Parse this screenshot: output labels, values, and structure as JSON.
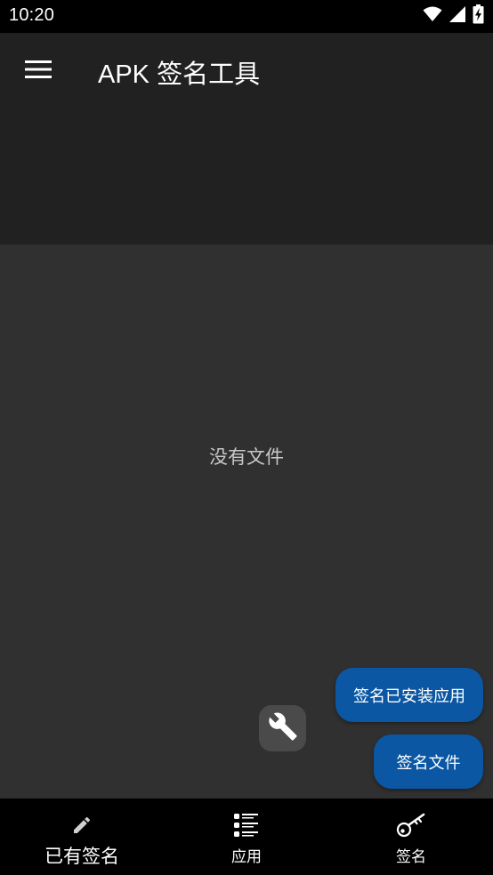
{
  "status_bar": {
    "time": "10:20",
    "icons": [
      "wifi-icon",
      "cell-signal-icon",
      "battery-charging-icon"
    ]
  },
  "app_bar": {
    "title": "APK 签名工具",
    "menu_icon": "menu-icon"
  },
  "content": {
    "empty_message": "没有文件"
  },
  "fabs": {
    "tool_icon": "wrench-icon",
    "sign_installed_label": "签名已安装应用",
    "sign_file_label": "签名文件"
  },
  "bottom_nav": {
    "items": [
      {
        "label": "已有签名",
        "icon": "pencil-icon"
      },
      {
        "label": "应用",
        "icon": "list-icon"
      },
      {
        "label": "签名",
        "icon": "key-icon"
      }
    ]
  },
  "colors": {
    "app_bar": "#212121",
    "content_bg": "#303030",
    "fab_blue": "#0b57a4",
    "tool_fab": "#4a4a4a"
  }
}
